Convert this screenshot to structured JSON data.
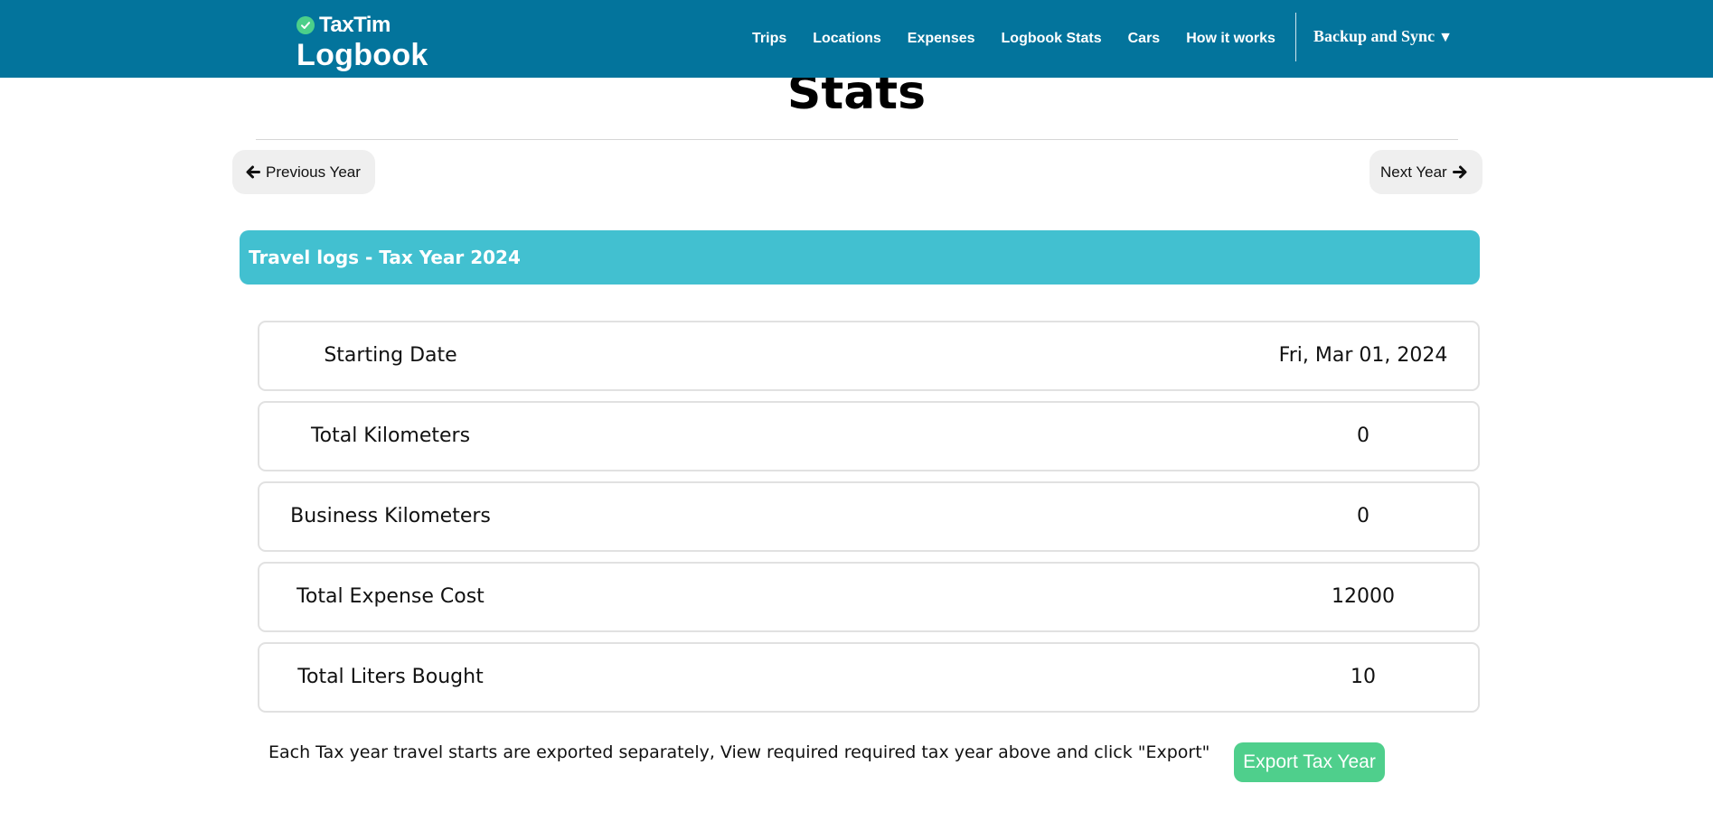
{
  "header": {
    "brand_top": "TaxTim",
    "brand_bottom": "Logbook",
    "nav": [
      {
        "label": "Trips"
      },
      {
        "label": "Locations"
      },
      {
        "label": "Expenses"
      },
      {
        "label": "Logbook Stats"
      },
      {
        "label": "Cars"
      },
      {
        "label": "How it works"
      }
    ],
    "backup_label": "Backup and Sync",
    "backup_icon": "caret-down-icon"
  },
  "page": {
    "title": "Stats",
    "prev_label": "Previous Year",
    "next_label": "Next Year"
  },
  "section": {
    "header": "Travel logs - Tax Year 2024"
  },
  "stats": [
    {
      "label": "Starting Date",
      "value": "Fri, Mar 01, 2024"
    },
    {
      "label": "Total Kilometers",
      "value": "0"
    },
    {
      "label": "Business Kilometers",
      "value": "0"
    },
    {
      "label": "Total Expense Cost",
      "value": "12000"
    },
    {
      "label": "Total Liters Bought",
      "value": "10"
    }
  ],
  "export": {
    "note": "Each Tax year travel starts are exported separately, View required required tax year above and click \"Export\"",
    "button_label": "Export Tax Year"
  },
  "colors": {
    "navbar": "#03749c",
    "section_header": "#42c0d0",
    "export_button": "#4fcf8c",
    "brand_check": "#4ccf8a"
  }
}
